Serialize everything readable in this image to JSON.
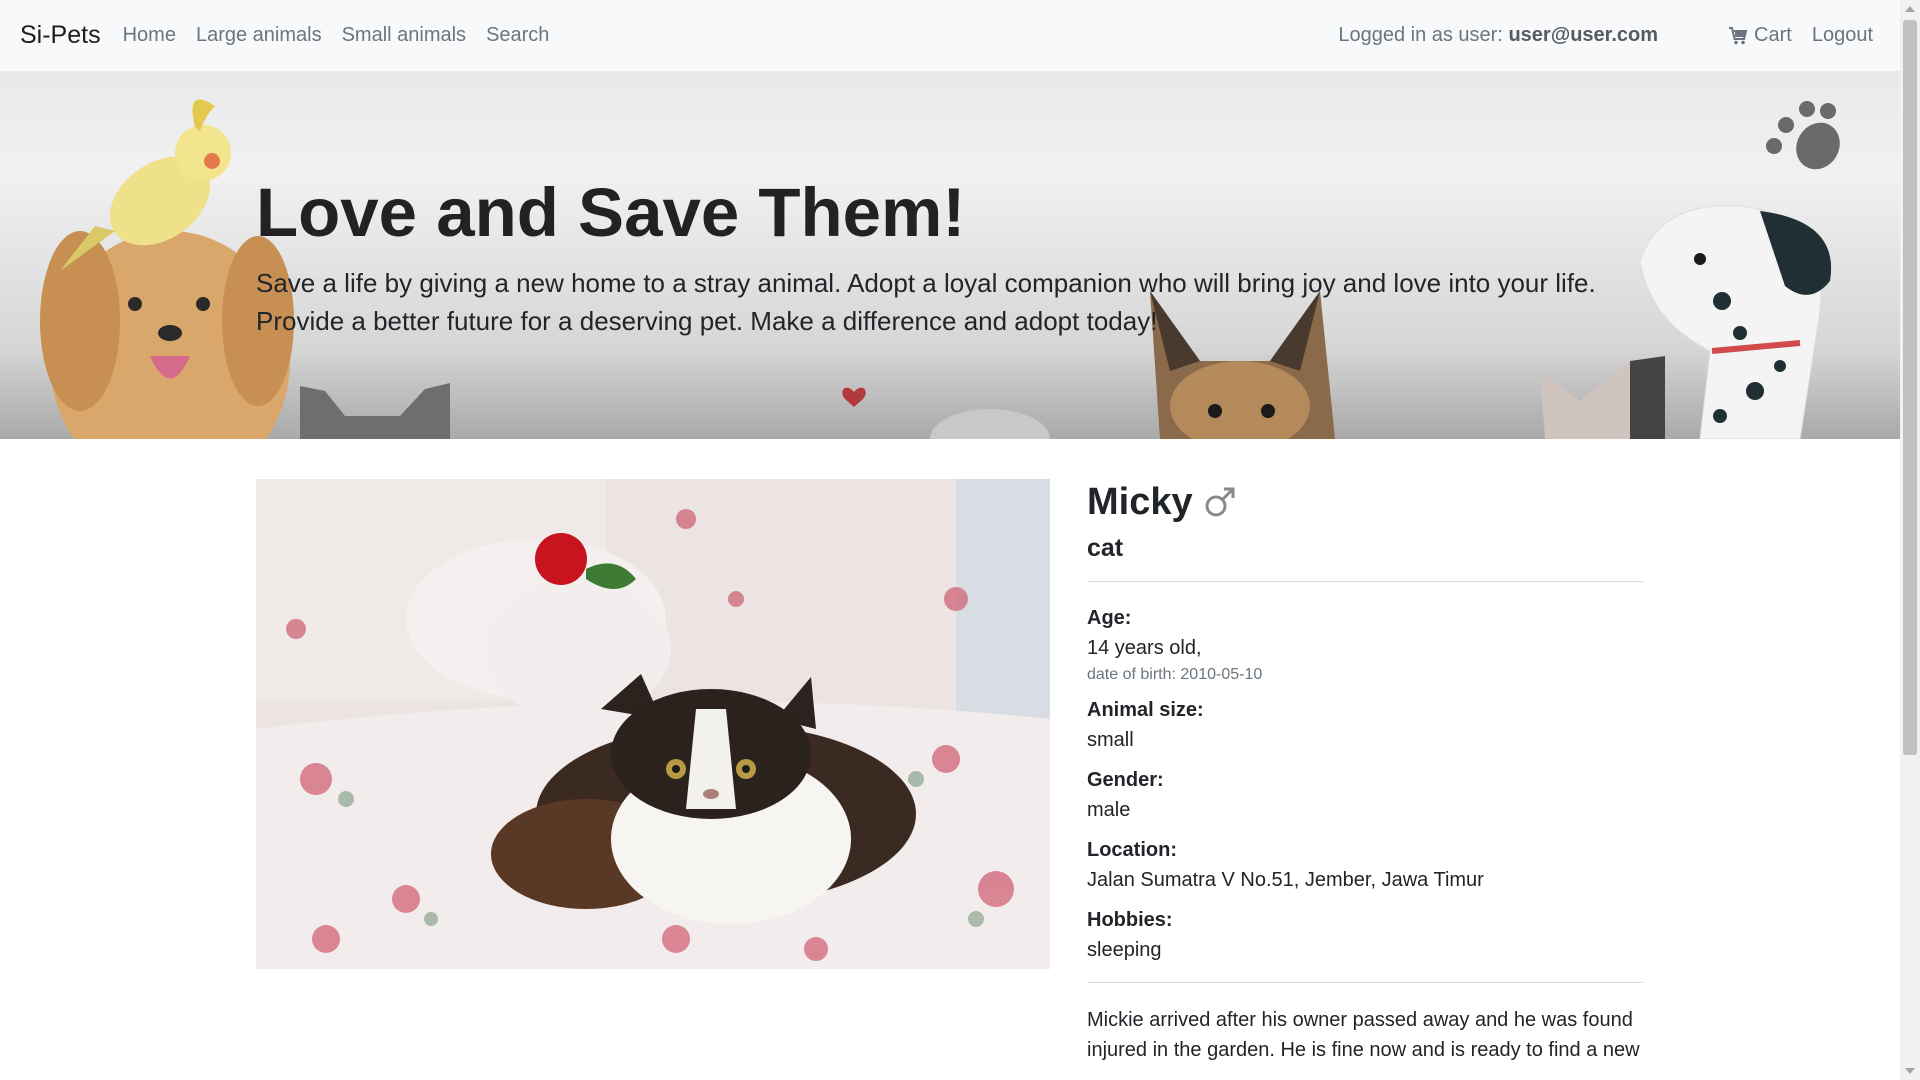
{
  "navbar": {
    "brand": "Si-Pets",
    "links": [
      "Home",
      "Large animals",
      "Small animals",
      "Search"
    ],
    "login_prefix": "Logged in as user: ",
    "user_email": "user@user.com",
    "cart_label": "Cart",
    "logout_label": "Logout"
  },
  "hero": {
    "title": "Love and Save Them!",
    "text": "Save a life by giving a new home to a stray animal. Adopt a loyal companion who will bring joy and love into your life. Provide a better future for a deserving pet. Make a difference and adopt today!"
  },
  "pet": {
    "name": "Micky",
    "gender_symbol": "♂",
    "species": "cat",
    "age_label": "Age:",
    "age_value": "14 years old,",
    "dob": "date of birth: 2010-05-10",
    "size_label": "Animal size:",
    "size_value": "small",
    "gender_label": "Gender:",
    "gender_value": "male",
    "location_label": "Location:",
    "location_value": "Jalan Sumatra V No.51, Jember, Jawa Timur",
    "hobbies_label": "Hobbies:",
    "hobbies_value": "sleeping",
    "description": "Mickie arrived after his owner passed away and he was found injured in the garden. He is fine now and is ready to find a new"
  },
  "colors": {
    "navbar_bg": "#f8f9fa",
    "nav_link": "#6c757d",
    "text": "#212529"
  },
  "icons": [
    "cart-icon",
    "male-icon",
    "paw-icon",
    "heart-icon"
  ]
}
